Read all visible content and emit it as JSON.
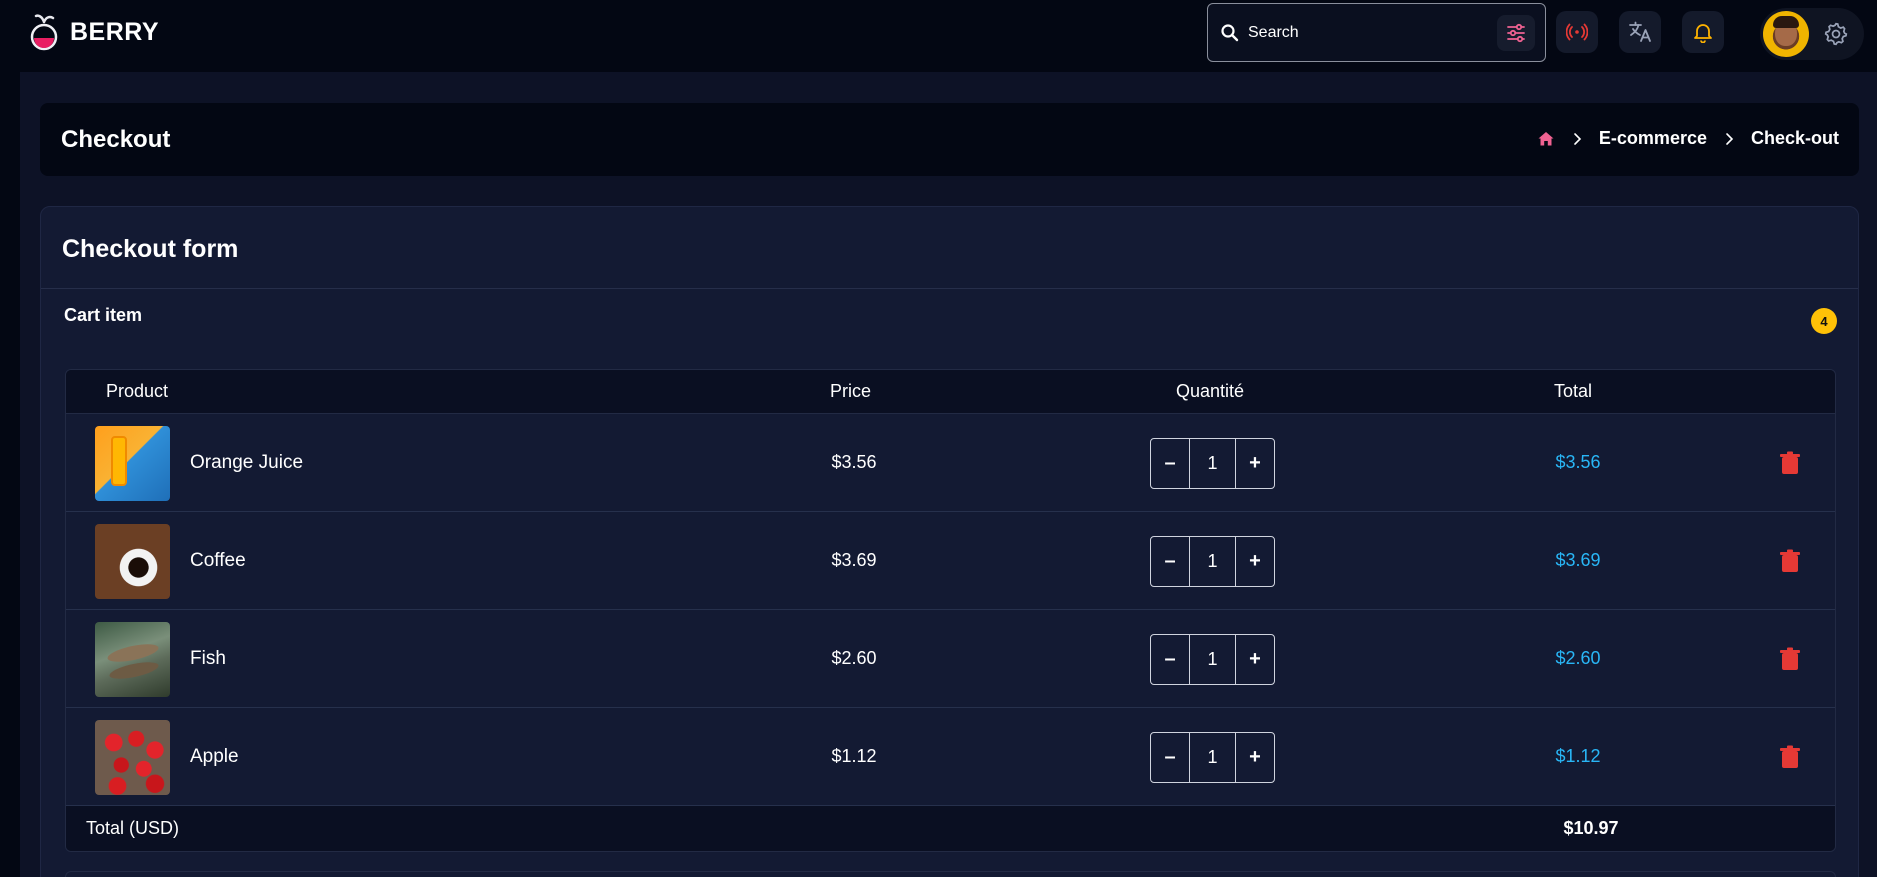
{
  "brand": {
    "name": "BERRY"
  },
  "search": {
    "placeholder": "Search"
  },
  "page": {
    "title": "Checkout",
    "breadcrumb": [
      "E-commerce",
      "Check-out"
    ]
  },
  "card": {
    "title": "Checkout form",
    "cart_label": "Cart item",
    "cart_count": "4"
  },
  "table": {
    "headers": {
      "product": "Product",
      "price": "Price",
      "qty": "Quantité",
      "total": "Total"
    },
    "rows": [
      {
        "name": "Orange Juice",
        "price": "$3.56",
        "qty": "1",
        "total": "$3.56"
      },
      {
        "name": "Coffee",
        "price": "$3.69",
        "qty": "1",
        "total": "$3.69"
      },
      {
        "name": "Fish",
        "price": "$2.60",
        "qty": "1",
        "total": "$2.60"
      },
      {
        "name": "Apple",
        "price": "$1.12",
        "qty": "1",
        "total": "$1.12"
      }
    ],
    "footer": {
      "label": "Total (USD)",
      "total": "$10.97"
    },
    "minus_label": "–",
    "plus_label": "+"
  },
  "colors": {
    "accent": "#29b6f6",
    "danger": "#e53935",
    "badge": "#ffc107",
    "home": "#f06292"
  },
  "icons": [
    "berry-logo-icon",
    "search-icon",
    "filter-icon",
    "live-icon",
    "translate-icon",
    "bell-icon",
    "settings-icon",
    "home-icon",
    "chevron-right-icon",
    "trash-icon"
  ]
}
